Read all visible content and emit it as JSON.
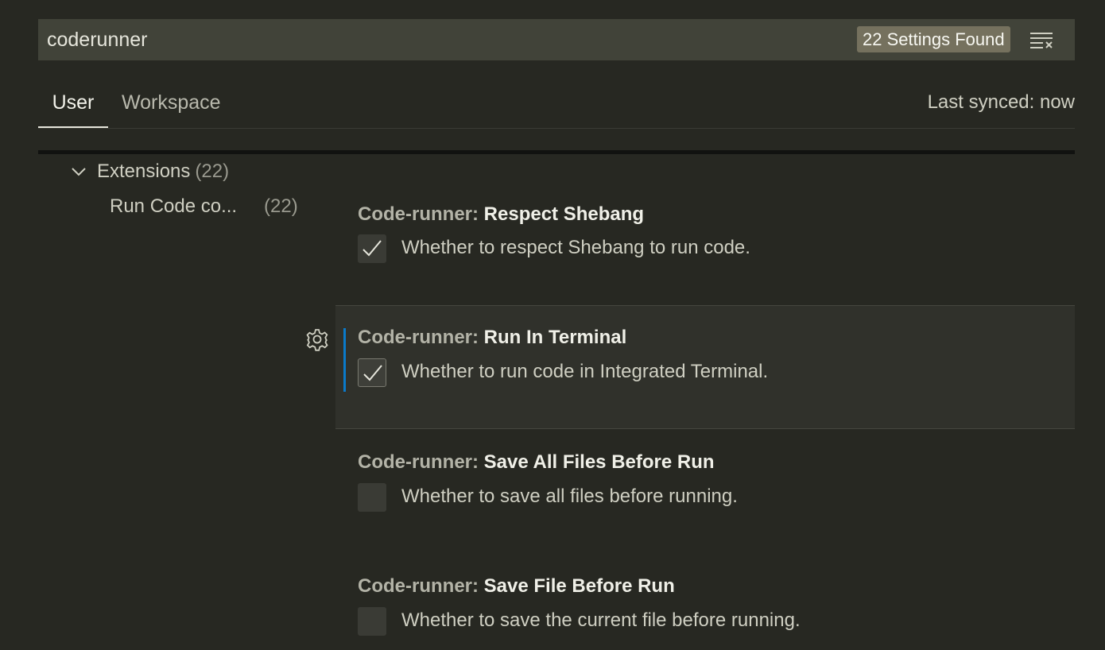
{
  "search": {
    "value": "coderunner",
    "results_badge": "22 Settings Found",
    "clear_icon": "clear-filter-icon"
  },
  "tabs": [
    {
      "label": "User",
      "active": true
    },
    {
      "label": "Workspace",
      "active": false
    }
  ],
  "sync_status": "Last synced: now",
  "toc": {
    "group": {
      "label": "Extensions",
      "count": "(22)",
      "expanded": true
    },
    "item": {
      "label": "Run Code co...",
      "count": "(22)"
    }
  },
  "settings": [
    {
      "category": "Code-runner: ",
      "name": "Respect Shebang",
      "description": "Whether to respect Shebang to run code.",
      "checked": true
    },
    {
      "category": "Code-runner: ",
      "name": "Run In Terminal",
      "description": "Whether to run code in Integrated Terminal.",
      "checked": true,
      "focused": true,
      "modified": true
    },
    {
      "category": "Code-runner: ",
      "name": "Save All Files Before Run",
      "description": "Whether to save all files before running.",
      "checked": false
    },
    {
      "category": "Code-runner: ",
      "name": "Save File Before Run",
      "description": "Whether to save the current file before running.",
      "checked": false
    }
  ],
  "colors": {
    "background": "#272822",
    "search_bg": "#414339",
    "badge_bg": "#75715e",
    "modified_indicator": "#0a7aca"
  }
}
